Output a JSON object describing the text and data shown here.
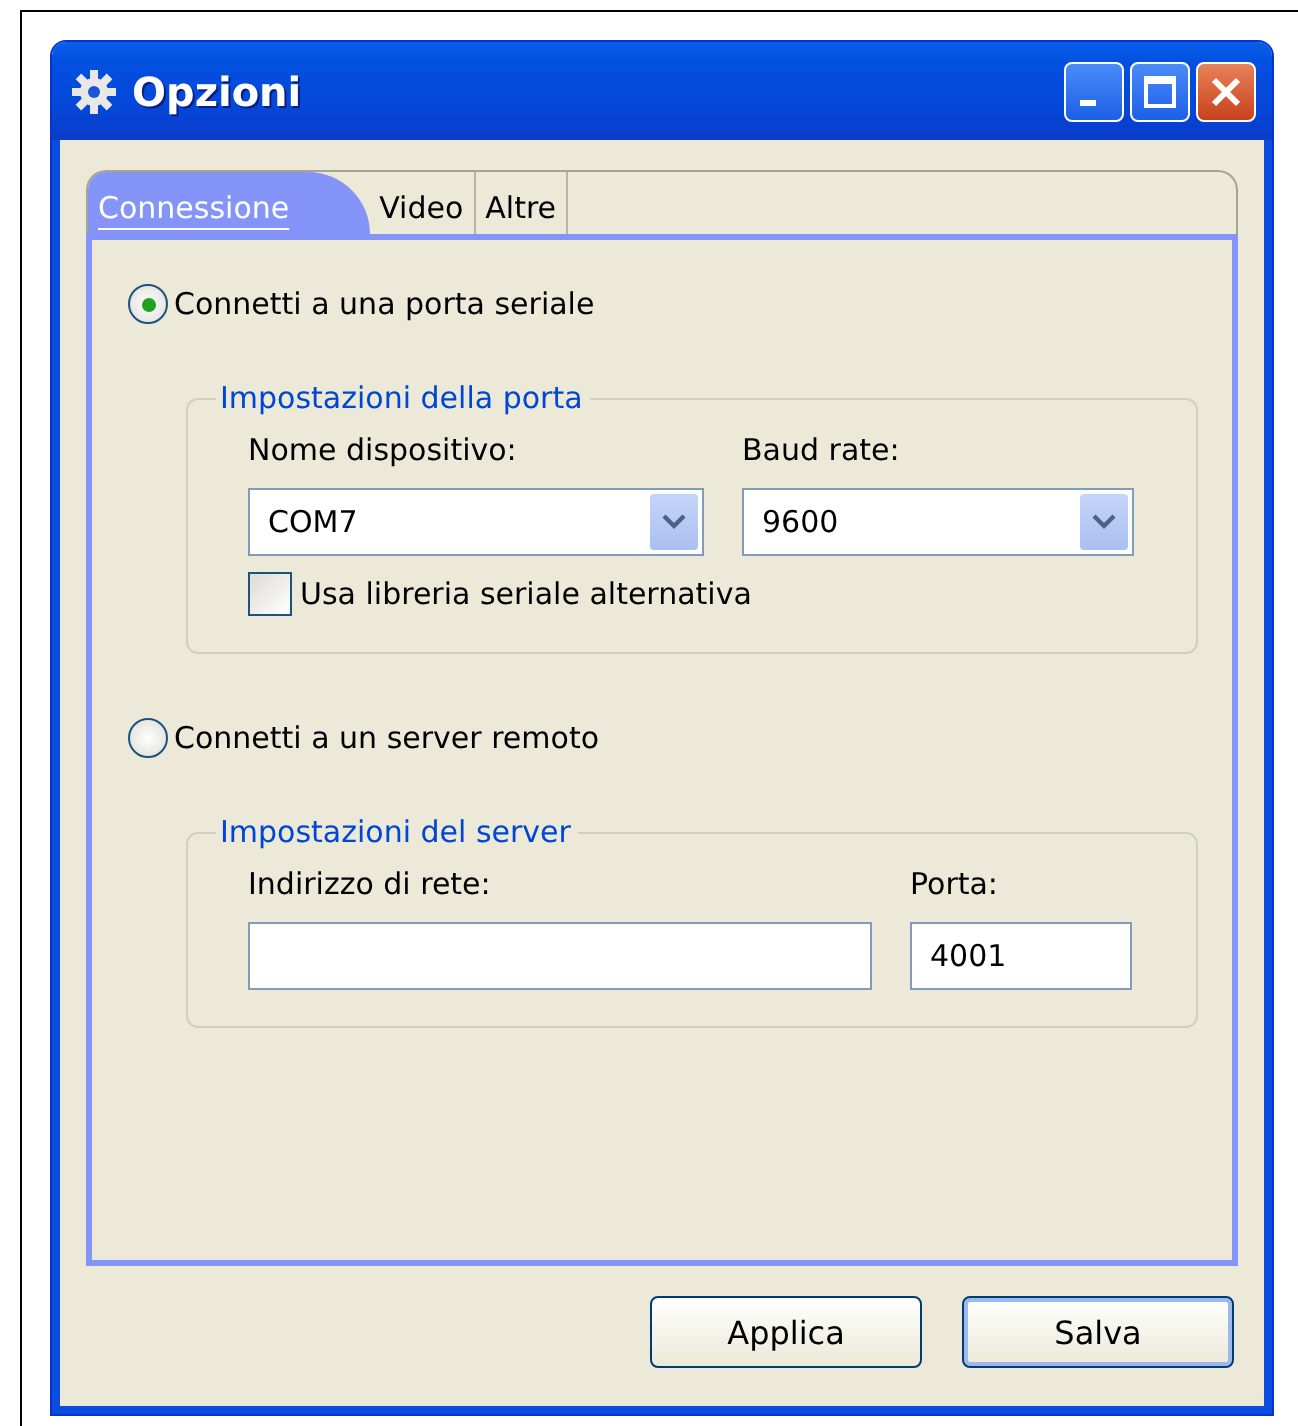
{
  "window": {
    "title": "Opzioni"
  },
  "tabs": [
    {
      "label": "Connessione",
      "selected": true
    },
    {
      "label": "Video",
      "selected": false
    },
    {
      "label": "Altre",
      "selected": false
    }
  ],
  "serial": {
    "option": {
      "label": "Connetti a una porta seriale",
      "selected": true
    },
    "group": {
      "title": "Impostazioni della porta",
      "device": {
        "label": "Nome dispositivo:",
        "value": "COM7"
      },
      "baud": {
        "label": "Baud rate:",
        "value": "9600"
      },
      "alt_library": {
        "label": "Usa libreria seriale alternativa",
        "checked": false
      }
    }
  },
  "remote": {
    "option": {
      "label": "Connetti a un server remoto",
      "selected": false
    },
    "group": {
      "title": "Impostazioni del server",
      "address": {
        "label": "Indirizzo di rete:"
      },
      "port": {
        "label": "Porta:",
        "value": "4001"
      }
    }
  },
  "buttons": [
    "Applica",
    "Salva"
  ]
}
